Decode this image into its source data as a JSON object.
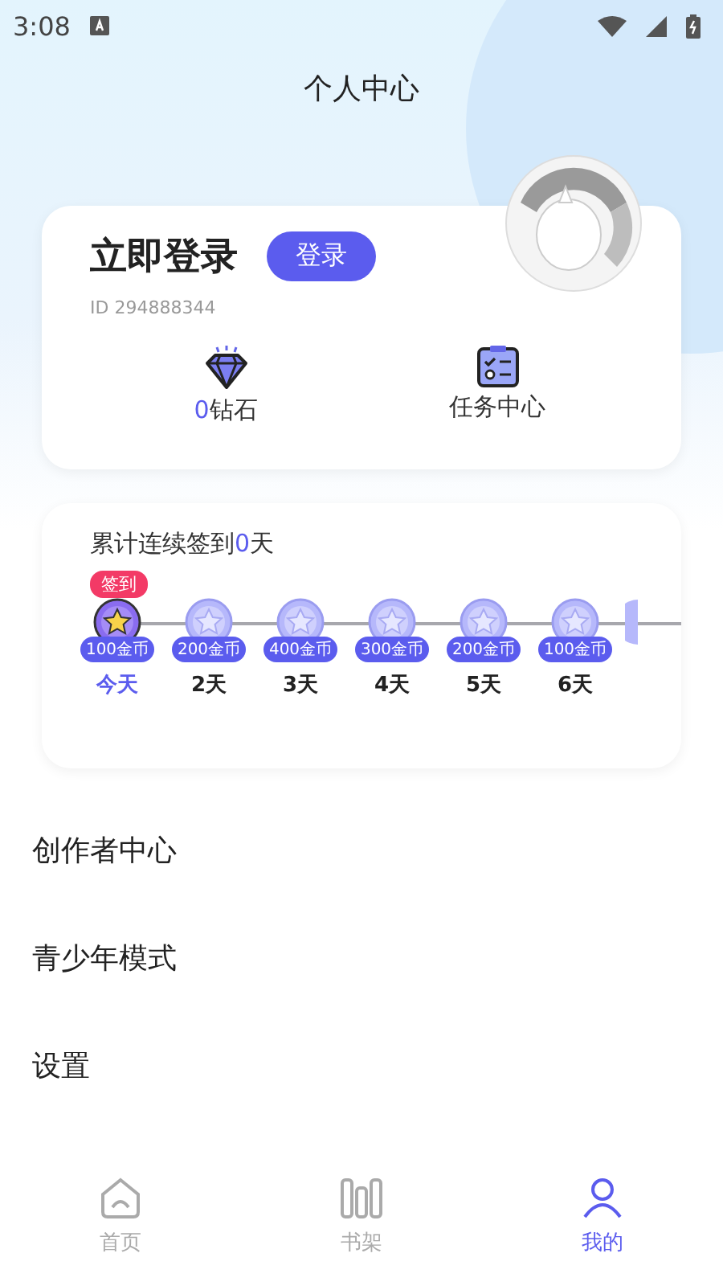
{
  "status_bar": {
    "time": "3:08"
  },
  "header": {
    "title": "个人中心"
  },
  "profile": {
    "name": "立即登录",
    "login_button": "登录",
    "user_id": "ID 294888344",
    "stats": [
      {
        "kind": "diamond",
        "value": "0",
        "label": "钻石"
      },
      {
        "kind": "tasks",
        "label": "任务中心"
      }
    ]
  },
  "checkin": {
    "prefix": "累计连续签到",
    "count": "0",
    "suffix": "天",
    "badge": "签到",
    "days": [
      {
        "reward": "100金币",
        "label": "今天",
        "selected": true
      },
      {
        "reward": "200金币",
        "label": "2天",
        "selected": false
      },
      {
        "reward": "400金币",
        "label": "3天",
        "selected": false
      },
      {
        "reward": "300金币",
        "label": "4天",
        "selected": false
      },
      {
        "reward": "200金币",
        "label": "5天",
        "selected": false
      },
      {
        "reward": "100金币",
        "label": "6天",
        "selected": false
      }
    ]
  },
  "menu": [
    "创作者中心",
    "青少年模式",
    "设置"
  ],
  "tabs": [
    {
      "kind": "home",
      "label": "首页",
      "selected": false
    },
    {
      "kind": "shelf",
      "label": "书架",
      "selected": false
    },
    {
      "kind": "me",
      "label": "我的",
      "selected": true
    }
  ]
}
